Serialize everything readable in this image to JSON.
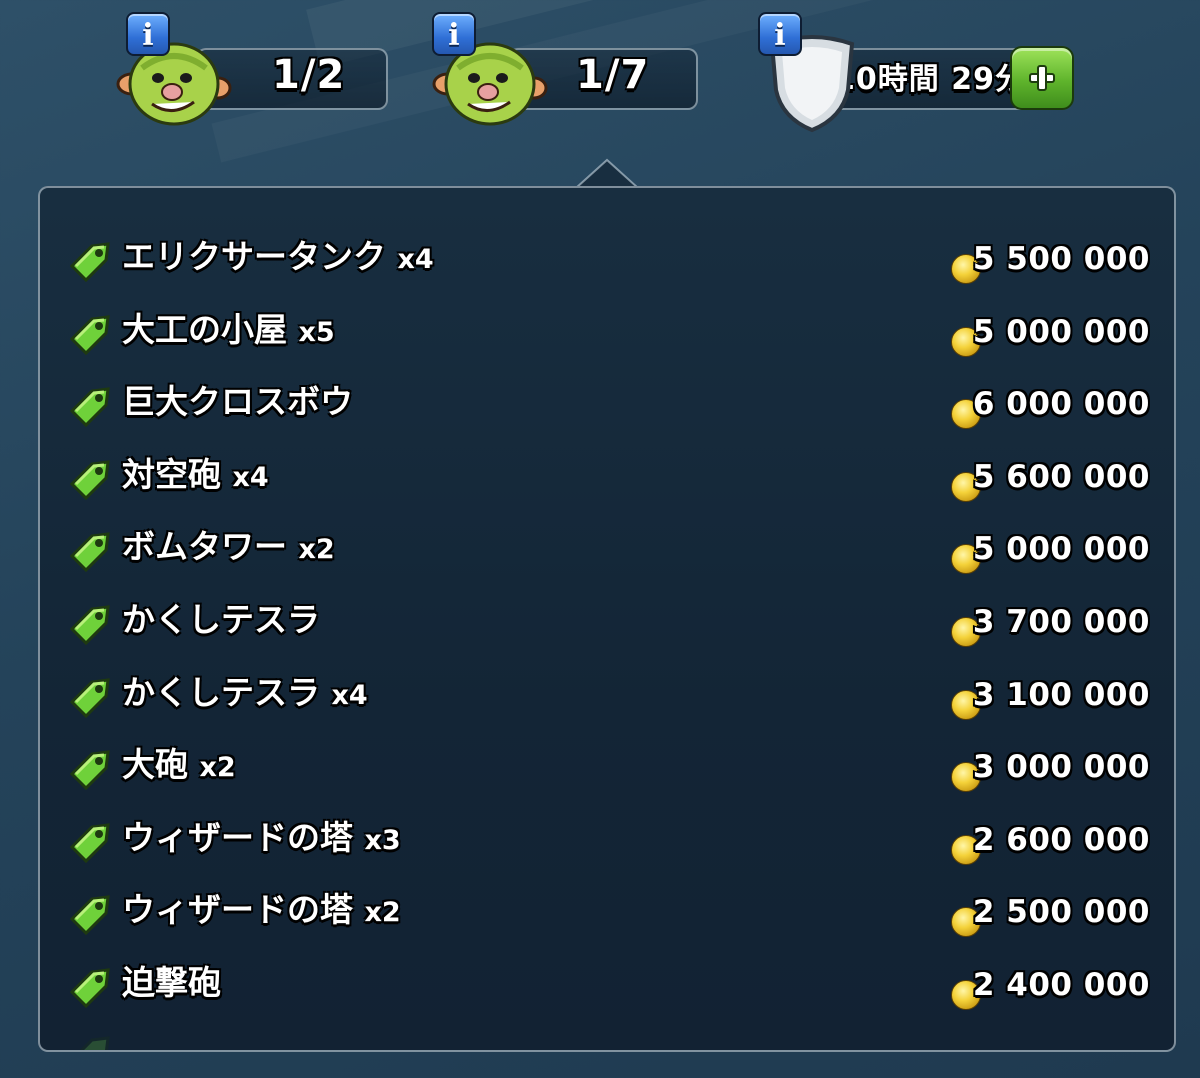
{
  "top_bar": {
    "builders": {
      "value": "1/2",
      "icon": "goblin-builder-icon"
    },
    "workers": {
      "value": "1/7",
      "icon": "goblin-builder-icon"
    },
    "shield": {
      "value": "10時間 29分",
      "icon": "shield-icon"
    },
    "info_label": "i"
  },
  "upgrades": [
    {
      "name": "エリクサータンク",
      "qty": "x4",
      "price": "5 500 000"
    },
    {
      "name": "大工の小屋",
      "qty": "x5",
      "price": "5 000 000"
    },
    {
      "name": "巨大クロスボウ",
      "qty": "",
      "price": "6 000 000"
    },
    {
      "name": "対空砲",
      "qty": "x4",
      "price": "5 600 000"
    },
    {
      "name": "ボムタワー",
      "qty": "x2",
      "price": "5 000 000"
    },
    {
      "name": "かくしテスラ",
      "qty": "",
      "price": "3 700 000"
    },
    {
      "name": "かくしテスラ",
      "qty": "x4",
      "price": "3 100 000"
    },
    {
      "name": "大砲",
      "qty": "x2",
      "price": "3 000 000"
    },
    {
      "name": "ウィザードの塔",
      "qty": "x3",
      "price": "2 600 000"
    },
    {
      "name": "ウィザードの塔",
      "qty": "x2",
      "price": "2 500 000"
    },
    {
      "name": "迫撃砲",
      "qty": "",
      "price": "2 400 000"
    }
  ],
  "colors": {
    "tag": "#6fd13a",
    "coin": "#f4d23a",
    "panel": "#152a3b"
  }
}
